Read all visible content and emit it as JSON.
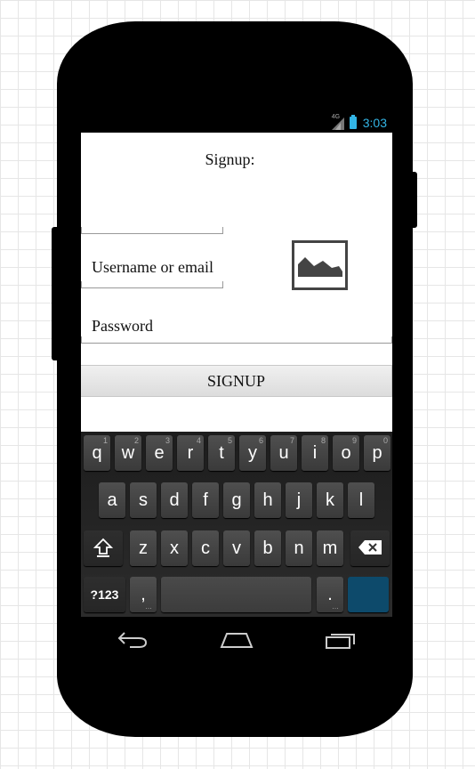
{
  "status_bar": {
    "network_type": "4G",
    "time": "3:03",
    "accent_color": "#33b5e5"
  },
  "form": {
    "title": "Signup:",
    "username_label": "Username or email",
    "password_label": "Password",
    "signup_button": "SIGNUP",
    "image_icon": "image-placeholder-icon"
  },
  "keyboard": {
    "row1": [
      "q",
      "w",
      "e",
      "r",
      "t",
      "y",
      "u",
      "i",
      "o",
      "p"
    ],
    "row1_hints": [
      "1",
      "2",
      "3",
      "4",
      "5",
      "6",
      "7",
      "8",
      "9",
      "0"
    ],
    "row2": [
      "a",
      "s",
      "d",
      "f",
      "g",
      "h",
      "j",
      "k",
      "l"
    ],
    "row3": [
      "z",
      "x",
      "c",
      "v",
      "b",
      "n",
      "m"
    ],
    "symbols_key": "?123",
    "comma_key": ",",
    "period_key": ".",
    "shift_icon": "shift-icon",
    "backspace_icon": "backspace-icon",
    "enter_color": "#0d4a6b"
  },
  "navbar": {
    "back_icon": "back-icon",
    "home_icon": "home-icon",
    "recents_icon": "recents-icon"
  }
}
